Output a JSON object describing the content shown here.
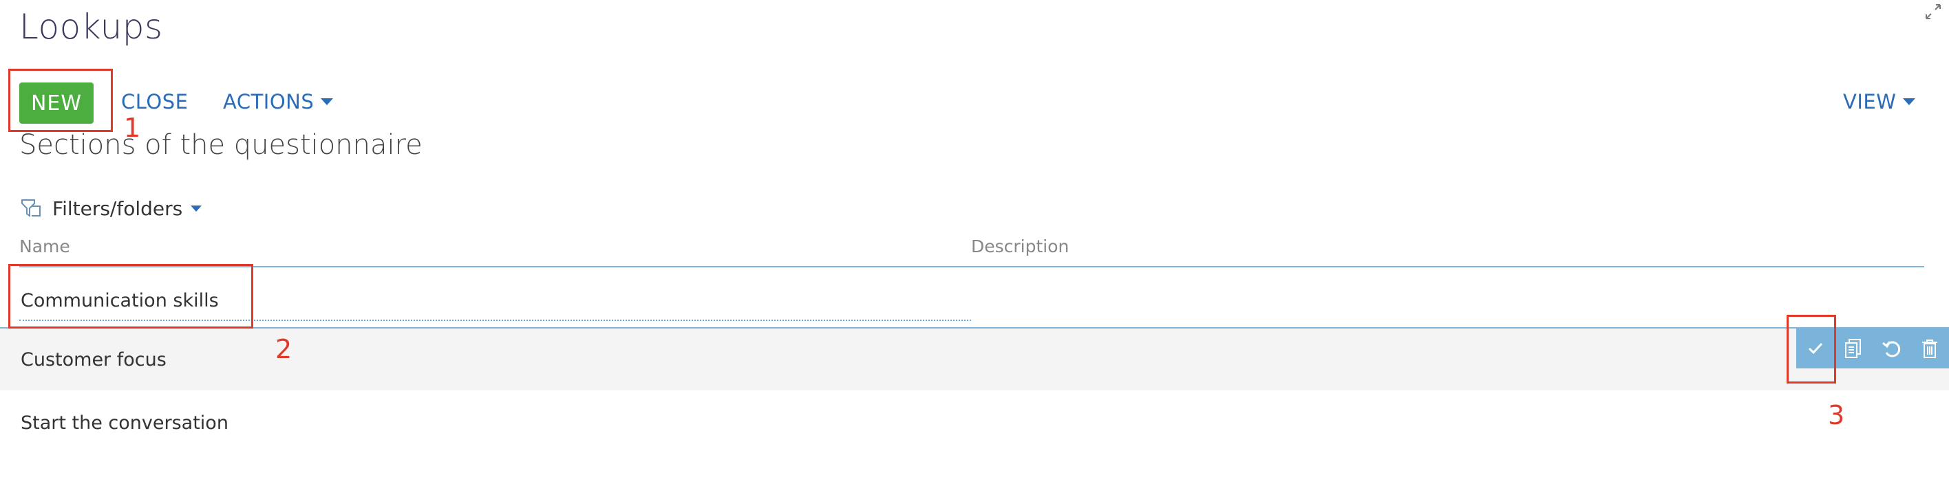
{
  "page": {
    "title": "Lookups"
  },
  "toolbar": {
    "new_label": "NEW",
    "close_label": "CLOSE",
    "actions_label": "ACTIONS",
    "view_label": "VIEW"
  },
  "section": {
    "title": "Sections of the questionnaire"
  },
  "filters": {
    "label": "Filters/folders"
  },
  "columns": {
    "name": "Name",
    "description": "Description"
  },
  "edit_row": {
    "name_value": "Communication skills",
    "name_placeholder": ""
  },
  "rows": [
    {
      "name": "Customer focus",
      "description": ""
    },
    {
      "name": "Start the conversation",
      "description": ""
    }
  ],
  "row_actions": [
    "check-icon",
    "copy-icon",
    "undo-icon",
    "trash-icon"
  ],
  "annotations": {
    "n1": "1",
    "n2": "2",
    "n3": "3"
  },
  "colors": {
    "accent_green": "#4cae3e",
    "link_blue": "#2b6cb8",
    "row_action_bg": "#7ab4da",
    "annotation_red": "#e23a2a"
  }
}
